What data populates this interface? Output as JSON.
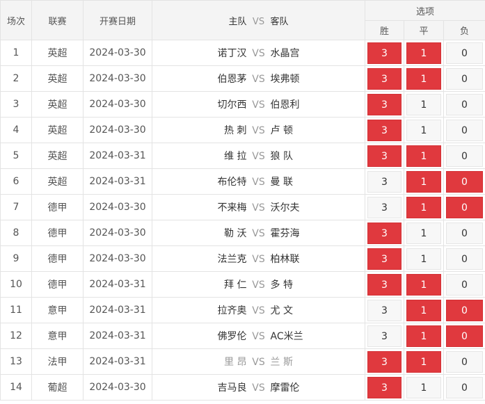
{
  "header": {
    "idx": "场次",
    "league": "联赛",
    "date": "开赛日期",
    "home": "主队",
    "vs": "VS",
    "away": "客队",
    "options": "选项",
    "win": "胜",
    "draw": "平",
    "lose": "负"
  },
  "colors": {
    "selected": "#e0393e",
    "unselected": "#f7f7f7"
  },
  "matches": [
    {
      "idx": "1",
      "league": "英超",
      "date": "2024-03-30",
      "home": "诺丁汉",
      "away": "水晶宫",
      "w": "3",
      "d": "1",
      "l": "0",
      "sel": [
        true,
        true,
        false
      ]
    },
    {
      "idx": "2",
      "league": "英超",
      "date": "2024-03-30",
      "home": "伯恩茅",
      "away": "埃弗顿",
      "w": "3",
      "d": "1",
      "l": "0",
      "sel": [
        true,
        true,
        false
      ]
    },
    {
      "idx": "3",
      "league": "英超",
      "date": "2024-03-30",
      "home": "切尔西",
      "away": "伯恩利",
      "w": "3",
      "d": "1",
      "l": "0",
      "sel": [
        true,
        false,
        false
      ]
    },
    {
      "idx": "4",
      "league": "英超",
      "date": "2024-03-30",
      "home": "热 刺",
      "away": "卢 顿",
      "w": "3",
      "d": "1",
      "l": "0",
      "sel": [
        true,
        false,
        false
      ]
    },
    {
      "idx": "5",
      "league": "英超",
      "date": "2024-03-31",
      "home": "维 拉",
      "away": "狼 队",
      "w": "3",
      "d": "1",
      "l": "0",
      "sel": [
        true,
        true,
        false
      ]
    },
    {
      "idx": "6",
      "league": "英超",
      "date": "2024-03-31",
      "home": "布伦特",
      "away": "曼 联",
      "w": "3",
      "d": "1",
      "l": "0",
      "sel": [
        false,
        true,
        true
      ]
    },
    {
      "idx": "7",
      "league": "德甲",
      "date": "2024-03-30",
      "home": "不来梅",
      "away": "沃尔夫",
      "w": "3",
      "d": "1",
      "l": "0",
      "sel": [
        false,
        true,
        true
      ]
    },
    {
      "idx": "8",
      "league": "德甲",
      "date": "2024-03-30",
      "home": "勒 沃",
      "away": "霍芬海",
      "w": "3",
      "d": "1",
      "l": "0",
      "sel": [
        true,
        false,
        false
      ]
    },
    {
      "idx": "9",
      "league": "德甲",
      "date": "2024-03-30",
      "home": "法兰克",
      "away": "柏林联",
      "w": "3",
      "d": "1",
      "l": "0",
      "sel": [
        true,
        false,
        false
      ]
    },
    {
      "idx": "10",
      "league": "德甲",
      "date": "2024-03-31",
      "home": "拜 仁",
      "away": "多 特",
      "w": "3",
      "d": "1",
      "l": "0",
      "sel": [
        true,
        true,
        false
      ]
    },
    {
      "idx": "11",
      "league": "意甲",
      "date": "2024-03-31",
      "home": "拉齐奥",
      "away": "尤 文",
      "w": "3",
      "d": "1",
      "l": "0",
      "sel": [
        false,
        true,
        true
      ]
    },
    {
      "idx": "12",
      "league": "意甲",
      "date": "2024-03-31",
      "home": "佛罗伦",
      "away": "AC米兰",
      "w": "3",
      "d": "1",
      "l": "0",
      "sel": [
        false,
        true,
        true
      ]
    },
    {
      "idx": "13",
      "league": "法甲",
      "date": "2024-03-31",
      "home": "里 昂",
      "away": "兰 斯",
      "w": "3",
      "d": "1",
      "l": "0",
      "sel": [
        true,
        true,
        false
      ],
      "muted": true
    },
    {
      "idx": "14",
      "league": "葡超",
      "date": "2024-03-30",
      "home": "吉马良",
      "away": "摩雷伦",
      "w": "3",
      "d": "1",
      "l": "0",
      "sel": [
        true,
        false,
        false
      ]
    }
  ]
}
